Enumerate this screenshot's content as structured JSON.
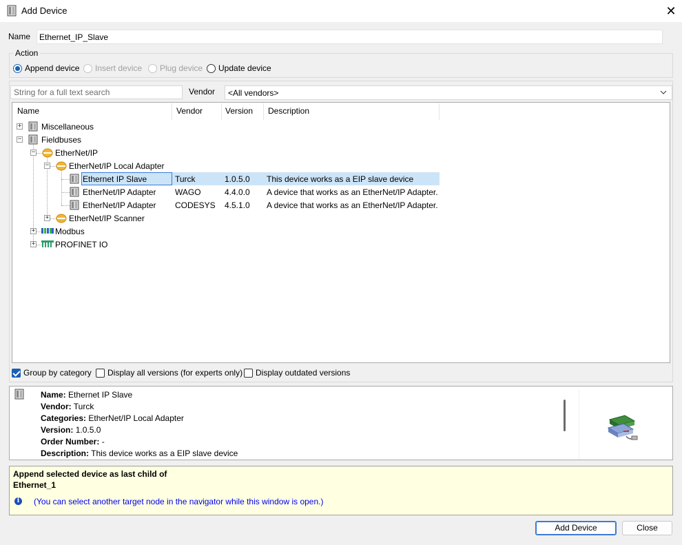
{
  "window": {
    "title": "Add Device",
    "close_icon": "close-icon",
    "close_glyph": "✕"
  },
  "name_field": {
    "label": "Name",
    "value": "Ethernet_IP_Slave"
  },
  "action": {
    "legend": "Action",
    "options": [
      {
        "label": "Append device",
        "selected": true,
        "enabled": true
      },
      {
        "label": "Insert device",
        "selected": false,
        "enabled": false
      },
      {
        "label": "Plug device",
        "selected": false,
        "enabled": false
      },
      {
        "label": "Update device",
        "selected": false,
        "enabled": true
      }
    ]
  },
  "search": {
    "placeholder": "String for a full text search",
    "vendor_label": "Vendor",
    "vendor_value": "<All vendors>"
  },
  "tree": {
    "columns": [
      "Name",
      "Vendor",
      "Version",
      "Description"
    ],
    "nodes": [
      {
        "name": "Miscellaneous",
        "icon": "device-icon"
      },
      {
        "name": "Fieldbuses",
        "icon": "device-icon"
      },
      {
        "name": "EtherNet/IP",
        "icon": "ethernet-ip-icon"
      },
      {
        "name": "EtherNet/IP Local Adapter",
        "icon": "ethernet-ip-icon"
      },
      {
        "name": "Ethernet IP Slave",
        "vendor": "Turck",
        "version": "1.0.5.0",
        "description": "This device works as a EIP slave device",
        "icon": "device-icon",
        "selected": true
      },
      {
        "name": "EtherNet/IP Adapter",
        "vendor": "WAGO",
        "version": "4.4.0.0",
        "description": "A device that works as an EtherNet/IP Adapter.",
        "icon": "device-icon"
      },
      {
        "name": "EtherNet/IP Adapter",
        "vendor": "CODESYS",
        "version": "4.5.1.0",
        "description": "A device that works as an EtherNet/IP Adapter.",
        "icon": "device-icon"
      },
      {
        "name": "EtherNet/IP Scanner",
        "icon": "ethernet-ip-icon"
      },
      {
        "name": "Modbus",
        "icon": "modbus-icon"
      },
      {
        "name": "PROFINET IO",
        "icon": "profinet-icon"
      }
    ]
  },
  "options": {
    "group_by_category": {
      "label": "Group by category",
      "checked": true
    },
    "display_all_versions": {
      "label": "Display all versions (for experts only)",
      "checked": false
    },
    "display_outdated": {
      "label": "Display outdated versions",
      "checked": false
    }
  },
  "details": {
    "name_key": "Name:",
    "name_val": "Ethernet IP Slave",
    "vendor_key": "Vendor:",
    "vendor_val": "Turck",
    "categories_key": "Categories:",
    "categories_val": "EtherNet/IP Local Adapter",
    "version_key": "Version:",
    "version_val": "1.0.5.0",
    "order_key": "Order Number:",
    "order_val": "-",
    "description_key": "Description:",
    "description_val": "This device works as a EIP slave device"
  },
  "hint": {
    "line1": "Append selected device as last child of",
    "line2": "Ethernet_1",
    "info": "(You can select another target node in the navigator while this window is open.)"
  },
  "buttons": {
    "add": "Add Device",
    "close": "Close"
  },
  "colors": {
    "selection": "#cce4f7",
    "accent": "#1a5fb4",
    "hint_bg": "#ffffe1",
    "hint_link": "#0000ee"
  }
}
